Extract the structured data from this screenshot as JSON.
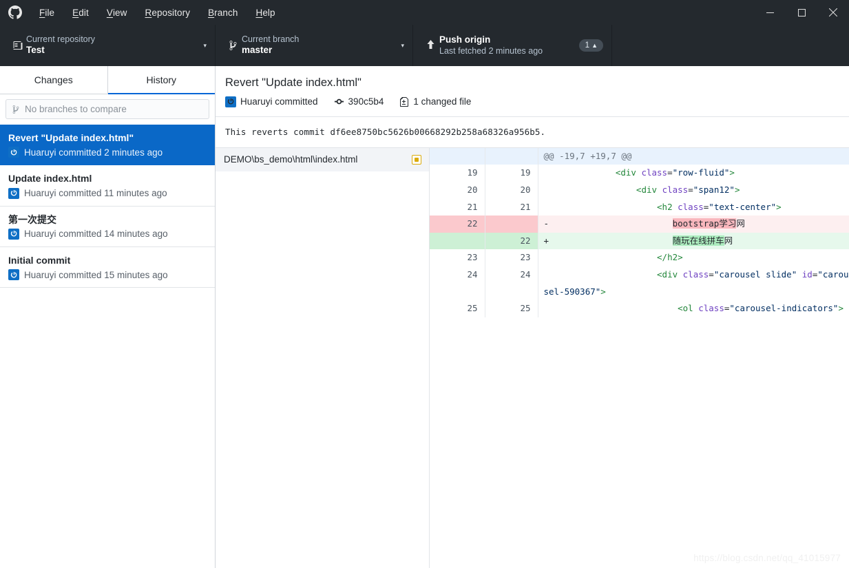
{
  "titlebar": {
    "logo_icon": "github-mark-icon",
    "menus": [
      {
        "label": "File",
        "accesskey": "F"
      },
      {
        "label": "Edit",
        "accesskey": "E"
      },
      {
        "label": "View",
        "accesskey": "V"
      },
      {
        "label": "Repository",
        "accesskey": "R"
      },
      {
        "label": "Branch",
        "accesskey": "B"
      },
      {
        "label": "Help",
        "accesskey": "H"
      }
    ],
    "minimize_label": "—",
    "maximize_label": "□",
    "close_label": "✕"
  },
  "toolbar": {
    "repository": {
      "label": "Current repository",
      "value": "Test",
      "icon": "repo-book-icon",
      "caret": "▾"
    },
    "branch": {
      "label": "Current branch",
      "value": "master",
      "icon": "git-branch-icon",
      "caret": "▾"
    },
    "push": {
      "label": "Push origin",
      "value": "Last fetched 2 minutes ago",
      "icon": "upload-arrow-icon",
      "badge_count": "1",
      "badge_arrow": "⬆"
    }
  },
  "sidebar": {
    "tabs": [
      {
        "id": "changes",
        "label": "Changes",
        "active": false
      },
      {
        "id": "history",
        "label": "History",
        "active": true
      }
    ],
    "compare": {
      "icon": "git-branch-icon",
      "placeholder": "No branches to compare",
      "value": ""
    },
    "commits": [
      {
        "title": "Revert \"Update index.html\"",
        "author_line": "Huaruyi committed 2 minutes ago",
        "avatar_icon": "power-avatar-icon",
        "selected": true
      },
      {
        "title": "Update index.html",
        "author_line": "Huaruyi committed 11 minutes ago",
        "avatar_icon": "power-avatar-icon",
        "selected": false
      },
      {
        "title": "第一次提交",
        "author_line": "Huaruyi committed 14 minutes ago",
        "avatar_icon": "power-avatar-icon",
        "selected": false
      },
      {
        "title": "Initial commit",
        "author_line": "Huaruyi committed 15 minutes ago",
        "avatar_icon": "power-avatar-icon",
        "selected": false
      }
    ]
  },
  "commit_detail": {
    "title": "Revert \"Update index.html\"",
    "author": "Huaruyi committed",
    "avatar_icon": "power-avatar-icon",
    "sha_icon": "git-commit-icon",
    "sha": "390c5b4",
    "files_icon": "file-diff-icon",
    "files_changed": "1 changed file",
    "description": "This reverts commit df6ee8750bc5626b00668292b258a68326a956b5."
  },
  "file_list": [
    {
      "path": "DEMO\\bs_demo\\html\\index.html",
      "status": "modified",
      "status_icon": "modified-dot-icon",
      "selected": true
    }
  ],
  "diff": {
    "hunk_header": "@@ -19,7 +19,7 @@",
    "rows": [
      {
        "type": "hunk",
        "old": "",
        "new": "",
        "sign": "",
        "text": "@@ -19,7 +19,7 @@"
      },
      {
        "type": "ctx",
        "old": "19",
        "new": "19",
        "sign": "",
        "text": "            <div class=\"row-fluid\">"
      },
      {
        "type": "ctx",
        "old": "20",
        "new": "20",
        "sign": "",
        "text": "                <div class=\"span12\">"
      },
      {
        "type": "ctx",
        "old": "21",
        "new": "21",
        "sign": "",
        "text": "                    <h2 class=\"text-center\">"
      },
      {
        "type": "del",
        "old": "22",
        "new": "",
        "sign": "-",
        "text": "                        bootstrap学习网",
        "highlight": "bootstrap学习",
        "tail": "网"
      },
      {
        "type": "add",
        "old": "",
        "new": "22",
        "sign": "+",
        "text": "                        随玩在线拼车网",
        "highlight": "随玩在线拼车",
        "tail": "网"
      },
      {
        "type": "ctx",
        "old": "23",
        "new": "23",
        "sign": "",
        "text": "                    </h2>"
      },
      {
        "type": "ctx",
        "old": "24",
        "new": "24",
        "sign": "",
        "text": "                    <div class=\"carousel slide\" id=\"carousel-590367\">"
      },
      {
        "type": "ctx",
        "old": "25",
        "new": "25",
        "sign": "",
        "text": "                        <ol class=\"carousel-indicators\">"
      }
    ]
  },
  "watermark": "https://blog.csdn.net/qq_41015977"
}
